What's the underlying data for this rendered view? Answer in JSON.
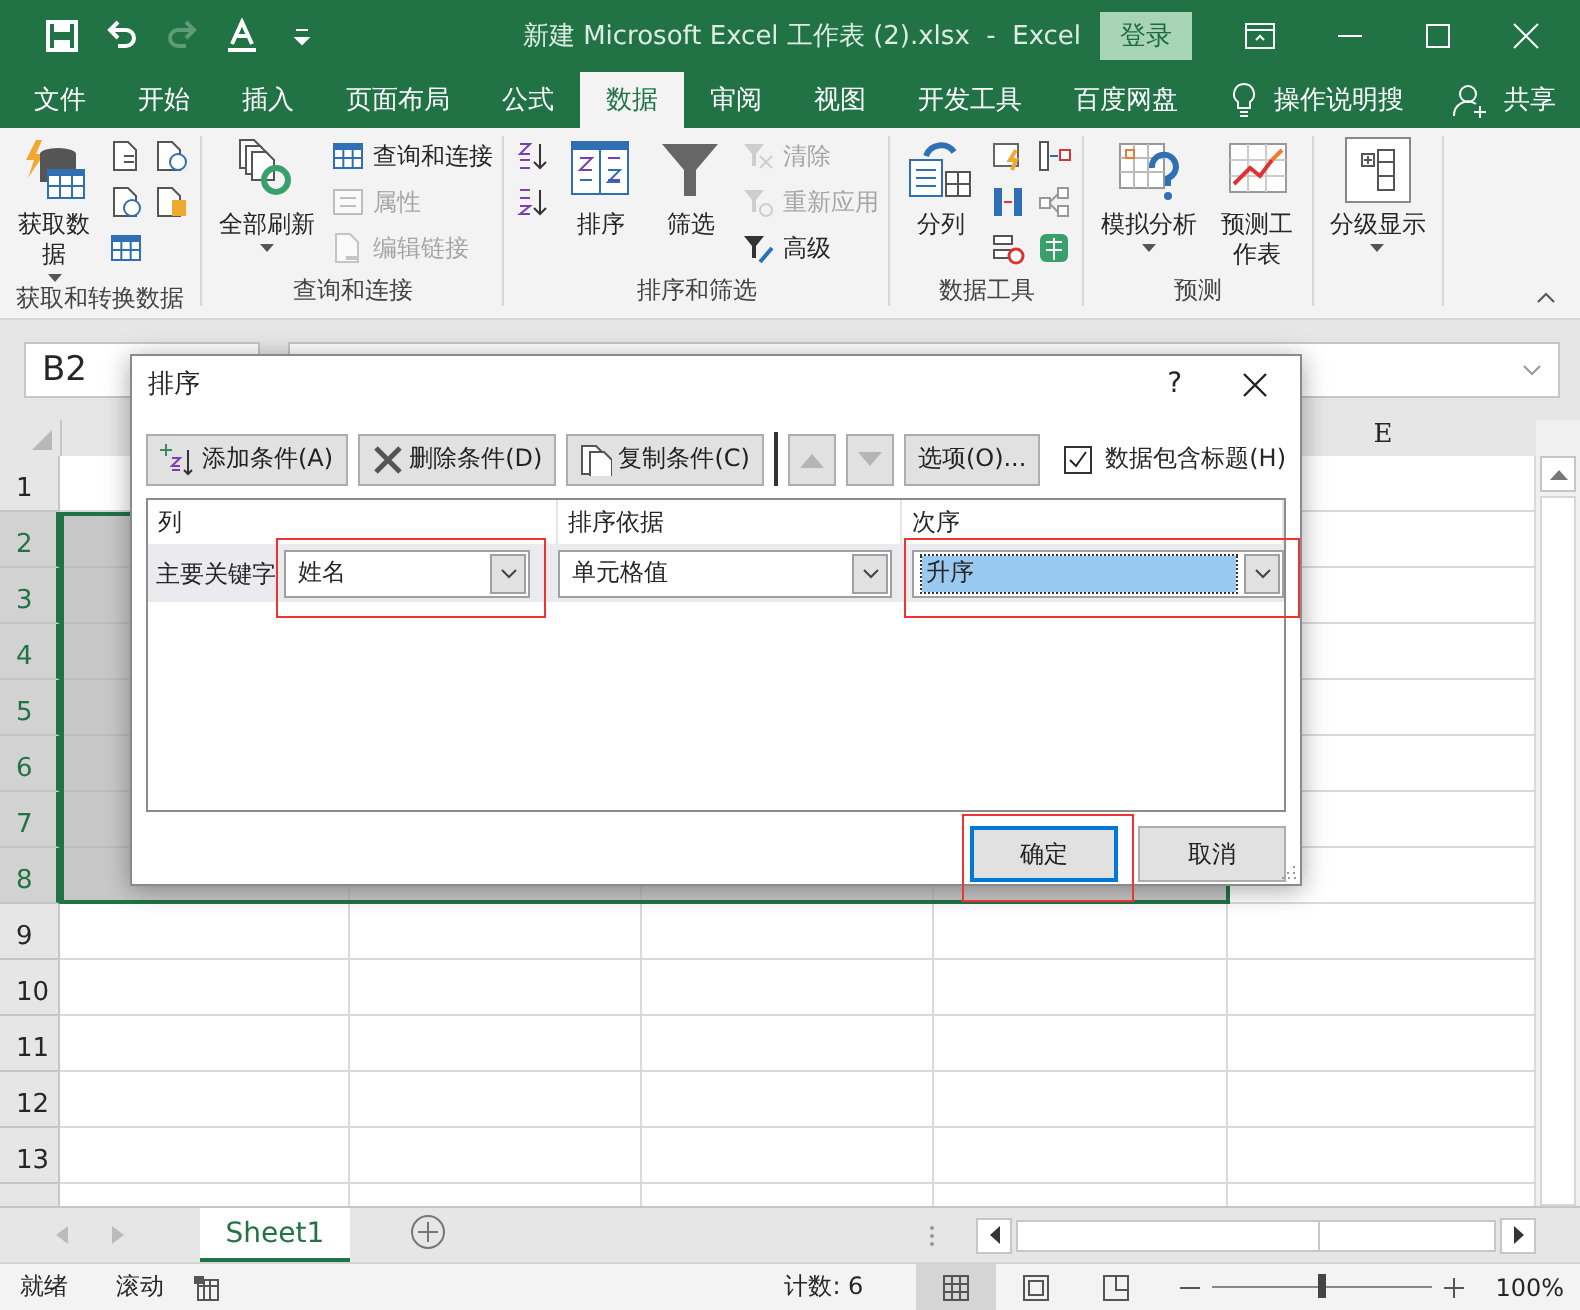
{
  "title_bar": {
    "title": "新建 Microsoft Excel 工作表 (2).xlsx  -  Excel",
    "login": "登录",
    "quick_access": [
      {
        "disabled": false
      },
      {
        "disabled": false
      },
      {
        "disabled": true
      },
      {
        "disabled": false
      },
      {
        "disabled": false
      }
    ]
  },
  "tabs": [
    {
      "label": "文件",
      "selected": false
    },
    {
      "label": "开始",
      "selected": false
    },
    {
      "label": "插入",
      "selected": false
    },
    {
      "label": "页面布局",
      "selected": false
    },
    {
      "label": "公式",
      "selected": false
    },
    {
      "label": "数据",
      "selected": true
    },
    {
      "label": "审阅",
      "selected": false
    },
    {
      "label": "视图",
      "selected": false
    },
    {
      "label": "开发工具",
      "selected": false
    },
    {
      "label": "百度网盘",
      "selected": false
    }
  ],
  "tell_me": "操作说明搜",
  "share": "共享",
  "ribbon": {
    "groups": [
      {
        "label": "获取和转换数据",
        "items": [
          {
            "kind": "large",
            "label": "获取数据",
            "wrapped": true,
            "dropdown": true,
            "disabled": false
          },
          {
            "kind": "icon",
            "disabled": false
          },
          {
            "kind": "icon",
            "disabled": false
          },
          {
            "kind": "icon",
            "disabled": false
          },
          {
            "kind": "icon",
            "disabled": false
          },
          {
            "kind": "icon",
            "disabled": false
          }
        ]
      },
      {
        "label": "查询和连接",
        "items": [
          {
            "kind": "large",
            "label": "全部刷新",
            "dropdown": true,
            "disabled": false
          },
          {
            "kind": "small",
            "label": "查询和连接",
            "disabled": false
          },
          {
            "kind": "small",
            "label": "属性",
            "disabled": true
          },
          {
            "kind": "small",
            "label": "编辑链接",
            "disabled": true
          }
        ]
      },
      {
        "label": "排序和筛选",
        "items": [
          {
            "kind": "icon",
            "disabled": false
          },
          {
            "kind": "icon",
            "disabled": false
          },
          {
            "kind": "large",
            "label": "排序",
            "dropdown": false,
            "disabled": false
          },
          {
            "kind": "large",
            "label": "筛选",
            "dropdown": false,
            "disabled": false
          },
          {
            "kind": "small",
            "label": "清除",
            "disabled": true
          },
          {
            "kind": "small",
            "label": "重新应用",
            "disabled": true
          },
          {
            "kind": "small",
            "label": "高级",
            "disabled": false
          }
        ]
      },
      {
        "label": "数据工具",
        "items": [
          {
            "kind": "large",
            "label": "分列",
            "dropdown": false,
            "disabled": false
          },
          {
            "kind": "icon",
            "disabled": false
          },
          {
            "kind": "icon",
            "disabled": false
          },
          {
            "kind": "icon",
            "disabled": false
          },
          {
            "kind": "icon",
            "disabled": false
          },
          {
            "kind": "icon",
            "disabled": false
          },
          {
            "kind": "icon",
            "disabled": false
          }
        ]
      },
      {
        "label": "预测",
        "items": [
          {
            "kind": "large",
            "label": "模拟分析",
            "dropdown": true,
            "disabled": false
          },
          {
            "kind": "large",
            "label": "预测工作表",
            "wrapped": true,
            "dropdown": false,
            "disabled": false
          }
        ]
      },
      {
        "items": [
          {
            "kind": "large",
            "label": "分级显示",
            "dropdown": true,
            "disabled": false
          }
        ]
      }
    ]
  },
  "formula_bar": {
    "name_box": "B2"
  },
  "grid": {
    "column_header": "E",
    "rows": [
      {
        "label": "1",
        "selected": false
      },
      {
        "label": "2",
        "selected": true
      },
      {
        "label": "3",
        "selected": true
      },
      {
        "label": "4",
        "selected": true
      },
      {
        "label": "5",
        "selected": true
      },
      {
        "label": "6",
        "selected": true
      },
      {
        "label": "7",
        "selected": true
      },
      {
        "label": "8",
        "selected": true
      },
      {
        "label": "9",
        "selected": false
      },
      {
        "label": "10",
        "selected": false
      },
      {
        "label": "11",
        "selected": false
      },
      {
        "label": "12",
        "selected": false
      },
      {
        "label": "13",
        "selected": false
      }
    ]
  },
  "dialog": {
    "title": "排序",
    "help": "?",
    "toolbar": [
      {
        "kind": "add",
        "label": "添加条件(A)",
        "disabled": false
      },
      {
        "kind": "delete",
        "label": "删除条件(D)",
        "disabled": false
      },
      {
        "kind": "copy",
        "label": "复制条件(C)",
        "disabled": false
      },
      {
        "kind": "up",
        "disabled": true
      },
      {
        "kind": "down",
        "disabled": true
      },
      {
        "kind": "text",
        "label": "选项(O)...",
        "disabled": false
      }
    ],
    "has_headers": {
      "label": "数据包含标题(H)",
      "checked": true
    },
    "columns": [
      "列",
      "排序依据",
      "次序"
    ],
    "rows": [
      {
        "label": "主要关键字",
        "column": {
          "value": "姓名",
          "marked": true,
          "selected": false
        },
        "sort_on": {
          "value": "单元格值",
          "marked": false,
          "selected": false
        },
        "order": {
          "value": "升序",
          "marked": true,
          "selected": true
        }
      }
    ],
    "buttons": [
      {
        "label": "确定",
        "default": true,
        "marked": true
      },
      {
        "label": "取消",
        "default": false,
        "marked": false
      }
    ]
  },
  "sheet_tabs": [
    {
      "label": "Sheet1",
      "selected": true
    }
  ],
  "status_bar": {
    "texts": [
      "就绪",
      "滚动"
    ],
    "count": "计数: 6",
    "views": [
      {
        "selected": true
      },
      {
        "selected": false
      },
      {
        "selected": false
      }
    ],
    "zoom": {
      "level": 0.5,
      "label": "100%"
    }
  }
}
